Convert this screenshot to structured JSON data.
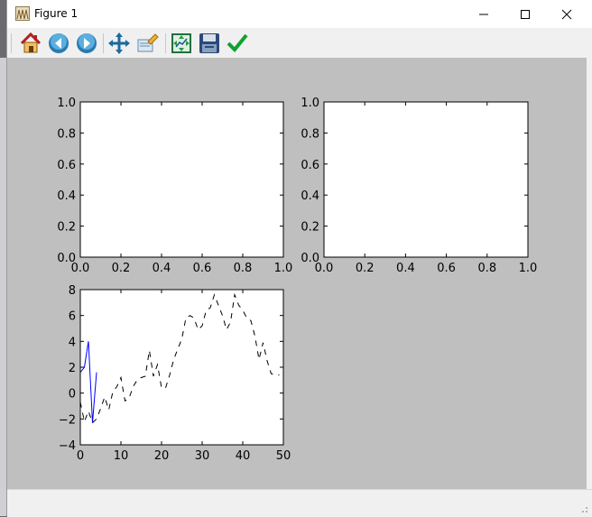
{
  "window": {
    "title": "Figure 1",
    "minimize_glyph": "—",
    "maximize_glyph": "☐",
    "close_glyph": "✕"
  },
  "toolbar": {
    "buttons": [
      {
        "name": "home-icon",
        "label": "Home"
      },
      {
        "name": "back-arrow-icon",
        "label": "Back"
      },
      {
        "name": "forward-arrow-icon",
        "label": "Forward"
      },
      {
        "name": "pan-icon",
        "label": "Pan"
      },
      {
        "name": "zoom-icon",
        "label": "Zoom"
      },
      {
        "name": "subplots-icon",
        "label": "Configure subplots"
      },
      {
        "name": "save-icon",
        "label": "Save"
      },
      {
        "name": "edit-checkmark-icon",
        "label": "Edit parameters"
      }
    ]
  },
  "chart_data": [
    {
      "type": "line",
      "xlim": [
        0,
        1
      ],
      "ylim": [
        0,
        1
      ],
      "xticks": [
        "0.0",
        "0.2",
        "0.4",
        "0.6",
        "0.8",
        "1.0"
      ],
      "yticks": [
        "0.0",
        "0.2",
        "0.4",
        "0.6",
        "0.8",
        "1.0"
      ],
      "series": []
    },
    {
      "type": "line",
      "xlim": [
        0,
        1
      ],
      "ylim": [
        0,
        1
      ],
      "xticks": [
        "0.0",
        "0.2",
        "0.4",
        "0.6",
        "0.8",
        "1.0"
      ],
      "yticks": [
        "0.0",
        "0.2",
        "0.4",
        "0.6",
        "0.8",
        "1.0"
      ],
      "series": []
    },
    {
      "type": "line",
      "xlim": [
        0,
        50
      ],
      "ylim": [
        -4,
        8
      ],
      "xticks": [
        "0",
        "10",
        "20",
        "30",
        "40",
        "50"
      ],
      "yticks": [
        "−4",
        "−2",
        "0",
        "2",
        "4",
        "6",
        "8"
      ],
      "series": [
        {
          "color": "#0000ff",
          "style": "solid",
          "x": [
            0,
            1,
            2,
            3,
            4
          ],
          "y": [
            1.6,
            2.0,
            4.0,
            -2.3,
            1.6
          ]
        },
        {
          "color": "#000000",
          "style": "dashed",
          "x": [
            0,
            1,
            2,
            3,
            4,
            5,
            6,
            7,
            8,
            9,
            10,
            11,
            12,
            13,
            14,
            15,
            16,
            17,
            18,
            19,
            20,
            21,
            22,
            23,
            24,
            25,
            26,
            27,
            28,
            29,
            30,
            31,
            32,
            33,
            34,
            35,
            36,
            37,
            38,
            39,
            40,
            41,
            42,
            43,
            44,
            45,
            46,
            47,
            48,
            49
          ],
          "y": [
            -0.7,
            -2.2,
            -1.4,
            -2.3,
            -2.0,
            -1.2,
            -0.3,
            -1.3,
            0.1,
            0.5,
            1.2,
            -0.6,
            -0.4,
            0.5,
            1.0,
            1.2,
            1.3,
            3.3,
            1.3,
            2.2,
            0.4,
            0.4,
            1.4,
            2.6,
            3.4,
            4.2,
            5.8,
            6.0,
            5.8,
            4.9,
            5.2,
            6.4,
            6.6,
            7.6,
            6.8,
            6.0,
            4.9,
            5.5,
            7.6,
            6.8,
            6.4,
            5.8,
            5.6,
            4.4,
            2.6,
            3.9,
            2.5,
            1.5,
            1.4,
            1.4
          ]
        }
      ]
    }
  ]
}
